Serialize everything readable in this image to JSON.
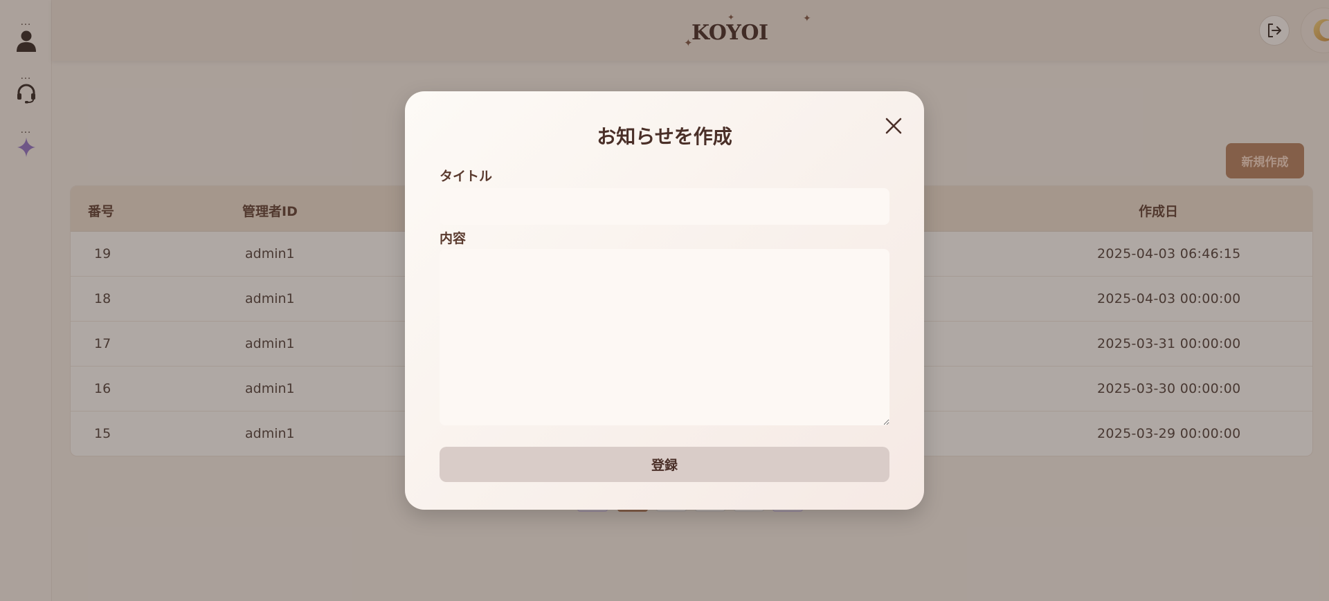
{
  "app": {
    "logo_text": "KOYOI"
  },
  "sidebar": {
    "items": [
      {
        "dots": "...",
        "icon": "user-icon"
      },
      {
        "dots": "...",
        "icon": "headset-icon"
      },
      {
        "dots": "...",
        "icon": "sparkle-icon"
      }
    ]
  },
  "header": {
    "logout_icon": "logout-icon",
    "theme_icon": "moon-icon"
  },
  "toolbar": {
    "new_label": "新規作成"
  },
  "table": {
    "columns": [
      "番号",
      "管理者ID",
      "作成日"
    ],
    "rows": [
      {
        "num": "19",
        "admin": "admin1",
        "date": "2025-04-03  06:46:15"
      },
      {
        "num": "18",
        "admin": "admin1",
        "date": "2025-04-03  00:00:00"
      },
      {
        "num": "17",
        "admin": "admin1",
        "date": "2025-03-31  00:00:00"
      },
      {
        "num": "16",
        "admin": "admin1",
        "date": "2025-03-30  00:00:00"
      },
      {
        "num": "15",
        "admin": "admin1",
        "date": "2025-03-29  00:00:00"
      }
    ]
  },
  "modal": {
    "title": "お知らせを作成",
    "title_label": "タイトル",
    "title_value": "",
    "title_placeholder": "",
    "content_label": "内容",
    "content_value": "",
    "content_placeholder": "",
    "submit_label": "登録"
  },
  "colors": {
    "accent": "#b17d5c",
    "sparkle": "#8e6fc7",
    "overlay": "rgba(70,55,48,0.42)"
  }
}
